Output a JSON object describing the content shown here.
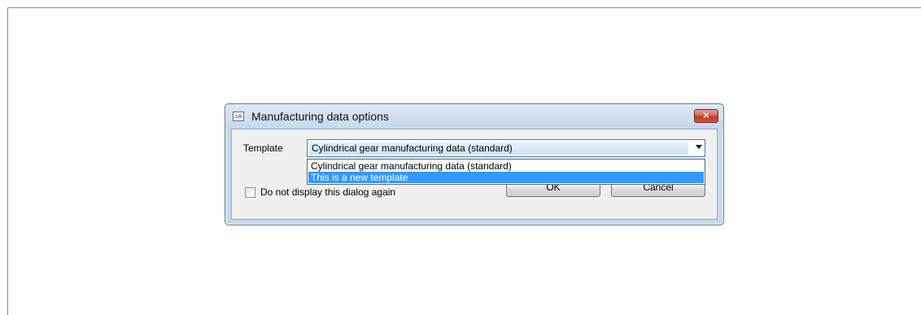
{
  "dialog": {
    "title": "Manufacturing data options",
    "app_icon_glyph": "cA",
    "close_glyph": "✕"
  },
  "template": {
    "label": "Template",
    "selected_value": "Cylindrical gear manufacturing data (standard)",
    "options": [
      "Cylindrical gear manufacturing data (standard)",
      "This is a new template"
    ],
    "highlighted_option_index": 1
  },
  "checkbox": {
    "label": "Do not display this dialog again",
    "checked": false
  },
  "buttons": {
    "ok_label": "OK",
    "cancel_label": "Cancel"
  },
  "colors": {
    "selection_blue": "#3399ff",
    "close_red": "#c0392b",
    "titlebar": "#c9d9ec"
  },
  "icons": [
    "application-icon",
    "close-icon",
    "chevron-down-icon"
  ]
}
